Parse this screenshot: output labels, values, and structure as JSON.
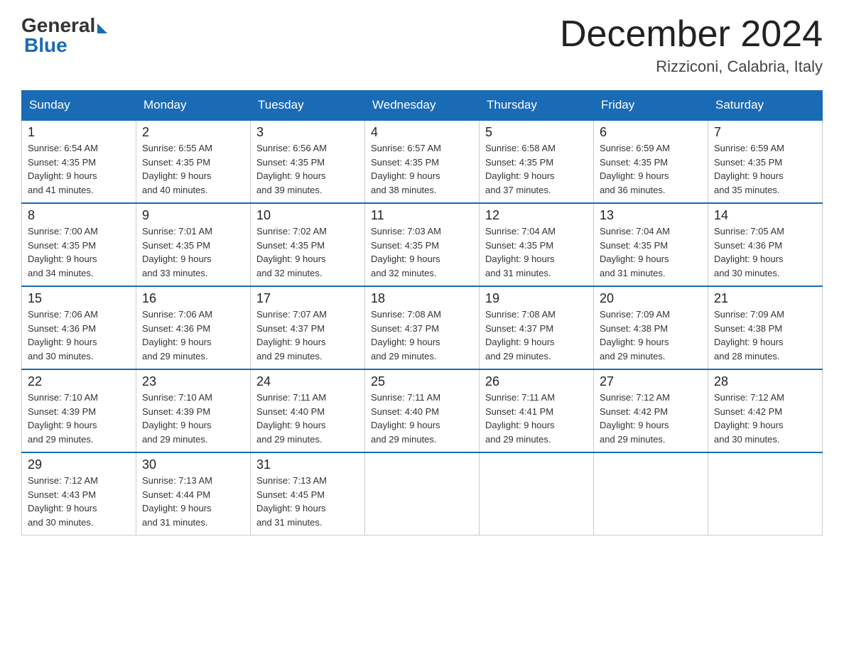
{
  "logo": {
    "general": "General",
    "blue": "Blue"
  },
  "title": "December 2024",
  "location": "Rizziconi, Calabria, Italy",
  "weekdays": [
    "Sunday",
    "Monday",
    "Tuesday",
    "Wednesday",
    "Thursday",
    "Friday",
    "Saturday"
  ],
  "weeks": [
    [
      {
        "day": "1",
        "sunrise": "6:54 AM",
        "sunset": "4:35 PM",
        "daylight": "9 hours and 41 minutes."
      },
      {
        "day": "2",
        "sunrise": "6:55 AM",
        "sunset": "4:35 PM",
        "daylight": "9 hours and 40 minutes."
      },
      {
        "day": "3",
        "sunrise": "6:56 AM",
        "sunset": "4:35 PM",
        "daylight": "9 hours and 39 minutes."
      },
      {
        "day": "4",
        "sunrise": "6:57 AM",
        "sunset": "4:35 PM",
        "daylight": "9 hours and 38 minutes."
      },
      {
        "day": "5",
        "sunrise": "6:58 AM",
        "sunset": "4:35 PM",
        "daylight": "9 hours and 37 minutes."
      },
      {
        "day": "6",
        "sunrise": "6:59 AM",
        "sunset": "4:35 PM",
        "daylight": "9 hours and 36 minutes."
      },
      {
        "day": "7",
        "sunrise": "6:59 AM",
        "sunset": "4:35 PM",
        "daylight": "9 hours and 35 minutes."
      }
    ],
    [
      {
        "day": "8",
        "sunrise": "7:00 AM",
        "sunset": "4:35 PM",
        "daylight": "9 hours and 34 minutes."
      },
      {
        "day": "9",
        "sunrise": "7:01 AM",
        "sunset": "4:35 PM",
        "daylight": "9 hours and 33 minutes."
      },
      {
        "day": "10",
        "sunrise": "7:02 AM",
        "sunset": "4:35 PM",
        "daylight": "9 hours and 32 minutes."
      },
      {
        "day": "11",
        "sunrise": "7:03 AM",
        "sunset": "4:35 PM",
        "daylight": "9 hours and 32 minutes."
      },
      {
        "day": "12",
        "sunrise": "7:04 AM",
        "sunset": "4:35 PM",
        "daylight": "9 hours and 31 minutes."
      },
      {
        "day": "13",
        "sunrise": "7:04 AM",
        "sunset": "4:35 PM",
        "daylight": "9 hours and 31 minutes."
      },
      {
        "day": "14",
        "sunrise": "7:05 AM",
        "sunset": "4:36 PM",
        "daylight": "9 hours and 30 minutes."
      }
    ],
    [
      {
        "day": "15",
        "sunrise": "7:06 AM",
        "sunset": "4:36 PM",
        "daylight": "9 hours and 30 minutes."
      },
      {
        "day": "16",
        "sunrise": "7:06 AM",
        "sunset": "4:36 PM",
        "daylight": "9 hours and 29 minutes."
      },
      {
        "day": "17",
        "sunrise": "7:07 AM",
        "sunset": "4:37 PM",
        "daylight": "9 hours and 29 minutes."
      },
      {
        "day": "18",
        "sunrise": "7:08 AM",
        "sunset": "4:37 PM",
        "daylight": "9 hours and 29 minutes."
      },
      {
        "day": "19",
        "sunrise": "7:08 AM",
        "sunset": "4:37 PM",
        "daylight": "9 hours and 29 minutes."
      },
      {
        "day": "20",
        "sunrise": "7:09 AM",
        "sunset": "4:38 PM",
        "daylight": "9 hours and 29 minutes."
      },
      {
        "day": "21",
        "sunrise": "7:09 AM",
        "sunset": "4:38 PM",
        "daylight": "9 hours and 28 minutes."
      }
    ],
    [
      {
        "day": "22",
        "sunrise": "7:10 AM",
        "sunset": "4:39 PM",
        "daylight": "9 hours and 29 minutes."
      },
      {
        "day": "23",
        "sunrise": "7:10 AM",
        "sunset": "4:39 PM",
        "daylight": "9 hours and 29 minutes."
      },
      {
        "day": "24",
        "sunrise": "7:11 AM",
        "sunset": "4:40 PM",
        "daylight": "9 hours and 29 minutes."
      },
      {
        "day": "25",
        "sunrise": "7:11 AM",
        "sunset": "4:40 PM",
        "daylight": "9 hours and 29 minutes."
      },
      {
        "day": "26",
        "sunrise": "7:11 AM",
        "sunset": "4:41 PM",
        "daylight": "9 hours and 29 minutes."
      },
      {
        "day": "27",
        "sunrise": "7:12 AM",
        "sunset": "4:42 PM",
        "daylight": "9 hours and 29 minutes."
      },
      {
        "day": "28",
        "sunrise": "7:12 AM",
        "sunset": "4:42 PM",
        "daylight": "9 hours and 30 minutes."
      }
    ],
    [
      {
        "day": "29",
        "sunrise": "7:12 AM",
        "sunset": "4:43 PM",
        "daylight": "9 hours and 30 minutes."
      },
      {
        "day": "30",
        "sunrise": "7:13 AM",
        "sunset": "4:44 PM",
        "daylight": "9 hours and 31 minutes."
      },
      {
        "day": "31",
        "sunrise": "7:13 AM",
        "sunset": "4:45 PM",
        "daylight": "9 hours and 31 minutes."
      },
      null,
      null,
      null,
      null
    ]
  ],
  "labels": {
    "sunrise": "Sunrise:",
    "sunset": "Sunset:",
    "daylight": "Daylight:"
  }
}
